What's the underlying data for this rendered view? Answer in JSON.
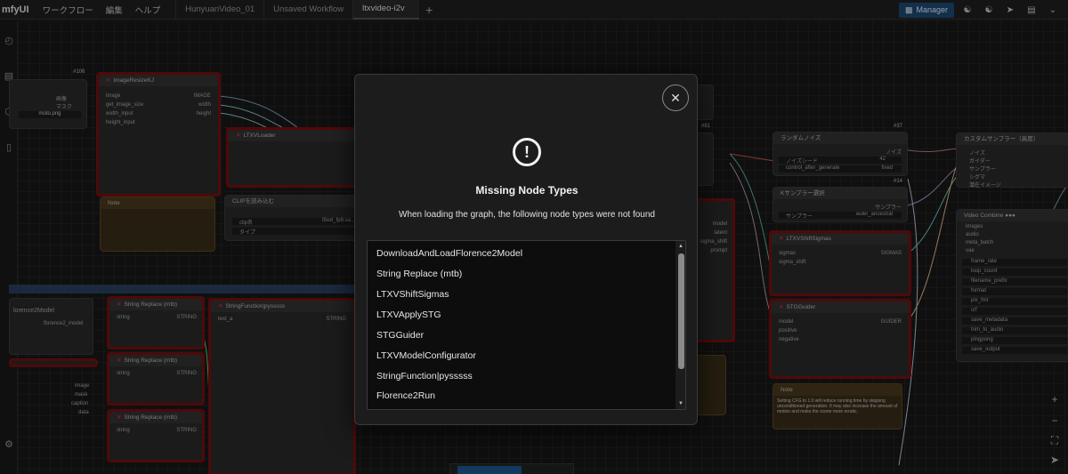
{
  "app": {
    "brand": "mfyUI"
  },
  "menu": [
    "ワークフロー",
    "編集",
    "ヘルプ"
  ],
  "tabs": [
    {
      "label": "HunyuanVideo_01",
      "active": false
    },
    {
      "label": "Unsaved Workflow",
      "active": false
    },
    {
      "label": "ltxvideo-i2v",
      "active": true
    }
  ],
  "toolbar": {
    "manager_label": "Manager"
  },
  "canvas": {
    "node_ids": {
      "n106": "#106",
      "n81": "#81",
      "n37": "#37",
      "n14": "#14"
    },
    "nodes": {
      "image_resize": "ImageResizeKJ",
      "ltxv_loader": "LTXVLoader",
      "clip_load": "CLIPを読み込む",
      "note": "Note",
      "random_noise": "ランダムノイズ",
      "ksampler_select": "Kサンプラー選択",
      "custom_sampler": "カスタムサンプラー（高度）",
      "shift_sigmas": "LTXVShiftSigmas",
      "stg_guider": "STGGuider",
      "video_combine": "Video Combine",
      "string_replace": "String Replace (mtb)",
      "string_function": "StringFunction|pysssss",
      "florence": "florence2_model"
    },
    "ports": {
      "image_resize_in": [
        "image",
        "get_image_size",
        "width_input",
        "height_input"
      ],
      "image_resize_out": [
        "IMAGE",
        "width",
        "height"
      ],
      "left_in": [
        "画像",
        "マスク"
      ],
      "left_value": "moto.png",
      "random_noise_fields": [
        {
          "label": "ノイズシード",
          "value": "42"
        },
        {
          "label": "control_after_generate",
          "value": "fixed"
        }
      ],
      "random_noise_out": "ノイズ",
      "ksampler_field": {
        "label": "サンプラー",
        "value": "euler_ancestral"
      },
      "ksampler_out": "サンプラー",
      "custom_sampler_in": [
        "ノイズ",
        "ガイダー",
        "サンプラー",
        "シグマ",
        "潜在イメージ"
      ],
      "shift_in": [
        "sigmas",
        "sigma_shift"
      ],
      "shift_out": "SIGMAS",
      "stg_in": [
        "model",
        "positive",
        "negative"
      ],
      "stg_out": "GUIDER",
      "video_in": [
        "images",
        "audio",
        "meta_batch",
        "vae"
      ],
      "video_fields": [
        "frame_rate",
        "loop_count",
        "filename_prefix",
        "format",
        "pix_fmt",
        "crf",
        "save_metadata",
        "trim_to_audio",
        "pingpong",
        "save_output"
      ],
      "clip_fields": [
        {
          "label": "clip名",
          "value": "t5xxl_fp8.sa..."
        },
        {
          "label": "タイプ",
          "value": ""
        }
      ],
      "mid_in": [
        "model",
        "latent",
        "sigma_shift",
        "prompt"
      ],
      "string_in": "string",
      "string_out": "STRING",
      "text_a": "text_a",
      "florence_in": [
        "image",
        "mask",
        "caption",
        "data"
      ],
      "note_text": "Note",
      "note_bottom_text": "Setting CFG to 1.0 will reduce running time by skipping unconditioned generation. It may also increase the amount of motion and make the scene more erratic."
    }
  },
  "modal": {
    "title": "Missing Node Types",
    "message": "When loading the graph, the following node types were not found",
    "items": [
      "DownloadAndLoadFlorence2Model",
      "String Replace (mtb)",
      "LTXVShiftSigmas",
      "LTXVApplySTG",
      "STGGuider",
      "LTXVModelConfigurator",
      "StringFunction|pysssss",
      "Florence2Run"
    ]
  }
}
